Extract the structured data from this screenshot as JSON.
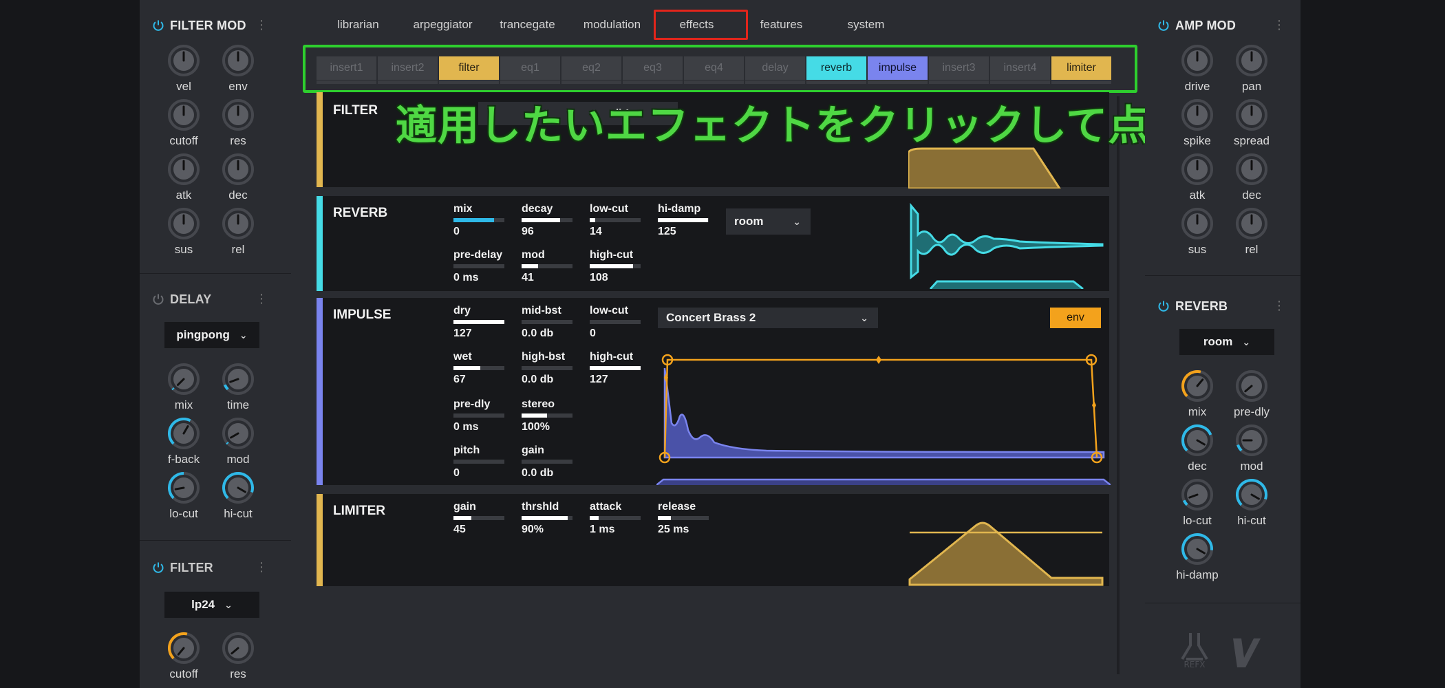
{
  "left": {
    "filter_mod": {
      "title": "FILTER MOD",
      "knobs": [
        "vel",
        "env",
        "cutoff",
        "res",
        "atk",
        "dec",
        "sus",
        "rel"
      ]
    },
    "delay": {
      "title": "DELAY",
      "mode": "pingpong",
      "knobs": [
        "mix",
        "time",
        "f-back",
        "mod",
        "lo-cut",
        "hi-cut"
      ]
    },
    "filter": {
      "title": "FILTER",
      "mode": "lp24",
      "knobs": [
        "cutoff",
        "res"
      ]
    }
  },
  "right": {
    "amp_mod": {
      "title": "AMP MOD",
      "knobs": [
        "drive",
        "pan",
        "spike",
        "spread",
        "atk",
        "dec",
        "sus",
        "rel"
      ]
    },
    "reverb": {
      "title": "REVERB",
      "mode": "room",
      "knobs": [
        "mix",
        "pre-dly",
        "dec",
        "mod",
        "lo-cut",
        "hi-cut",
        "hi-damp"
      ]
    }
  },
  "nav": {
    "tabs": [
      "librarian",
      "arpeggiator",
      "trancegate",
      "modulation",
      "effects",
      "features",
      "system"
    ],
    "active": "effects"
  },
  "inserts": [
    "insert1",
    "insert2",
    "filter",
    "eq1",
    "eq2",
    "eq3",
    "eq4",
    "delay",
    "reverb",
    "impulse",
    "insert3",
    "insert4",
    "limiter"
  ],
  "annotation": "適用したいエフェクトをクリックして点灯",
  "panels": {
    "filter": {
      "title": "FILTER",
      "mode_partial": "li 1"
    },
    "reverb": {
      "title": "REVERB",
      "type": "room",
      "params": [
        {
          "label": "mix",
          "value": "0",
          "fill": 0.8
        },
        {
          "label": "decay",
          "value": "96",
          "fill": 0.75
        },
        {
          "label": "low-cut",
          "value": "14",
          "fill": 0.11
        },
        {
          "label": "hi-damp",
          "value": "125",
          "fill": 0.98
        },
        {
          "label": "pre-delay",
          "value": "0 ms",
          "fill": 0.0
        },
        {
          "label": "mod",
          "value": "41",
          "fill": 0.32
        },
        {
          "label": "high-cut",
          "value": "108",
          "fill": 0.85
        }
      ]
    },
    "impulse": {
      "title": "IMPULSE",
      "preset": "Concert Brass 2",
      "env_label": "env",
      "params": [
        {
          "label": "dry",
          "value": "127",
          "fill": 1.0
        },
        {
          "label": "mid-bst",
          "value": "0.0 db",
          "fill": 0.0
        },
        {
          "label": "low-cut",
          "value": "0",
          "fill": 0.0
        },
        {
          "label": "wet",
          "value": "67",
          "fill": 0.53
        },
        {
          "label": "high-bst",
          "value": "0.0 db",
          "fill": 0.0
        },
        {
          "label": "high-cut",
          "value": "127",
          "fill": 1.0
        },
        {
          "label": "pre-dly",
          "value": "0 ms",
          "fill": 0.0
        },
        {
          "label": "stereo",
          "value": "100%",
          "fill": 0.5
        },
        {
          "label": "pitch",
          "value": "0",
          "fill": 0.0
        },
        {
          "label": "gain",
          "value": "0.0 db",
          "fill": 0.0
        }
      ]
    },
    "limiter": {
      "title": "LIMITER",
      "params": [
        {
          "label": "gain",
          "value": "45",
          "fill": 0.35
        },
        {
          "label": "thrshld",
          "value": "90%",
          "fill": 0.9
        },
        {
          "label": "attack",
          "value": "1 ms",
          "fill": 0.18
        },
        {
          "label": "release",
          "value": "25 ms",
          "fill": 0.25
        }
      ]
    }
  },
  "brand": {
    "logo_a": "REFX",
    "logo_b": "V"
  },
  "colors": {
    "filter": "#e1b64f",
    "reverb": "#45dbe6",
    "impulse": "#7a84ee",
    "limiter": "#e1b64f",
    "knob_blue": "#2fb9e8",
    "knob_orange": "#f3a21c",
    "highlight_red": "#e2251b",
    "highlight_green": "#2ecf2e"
  }
}
